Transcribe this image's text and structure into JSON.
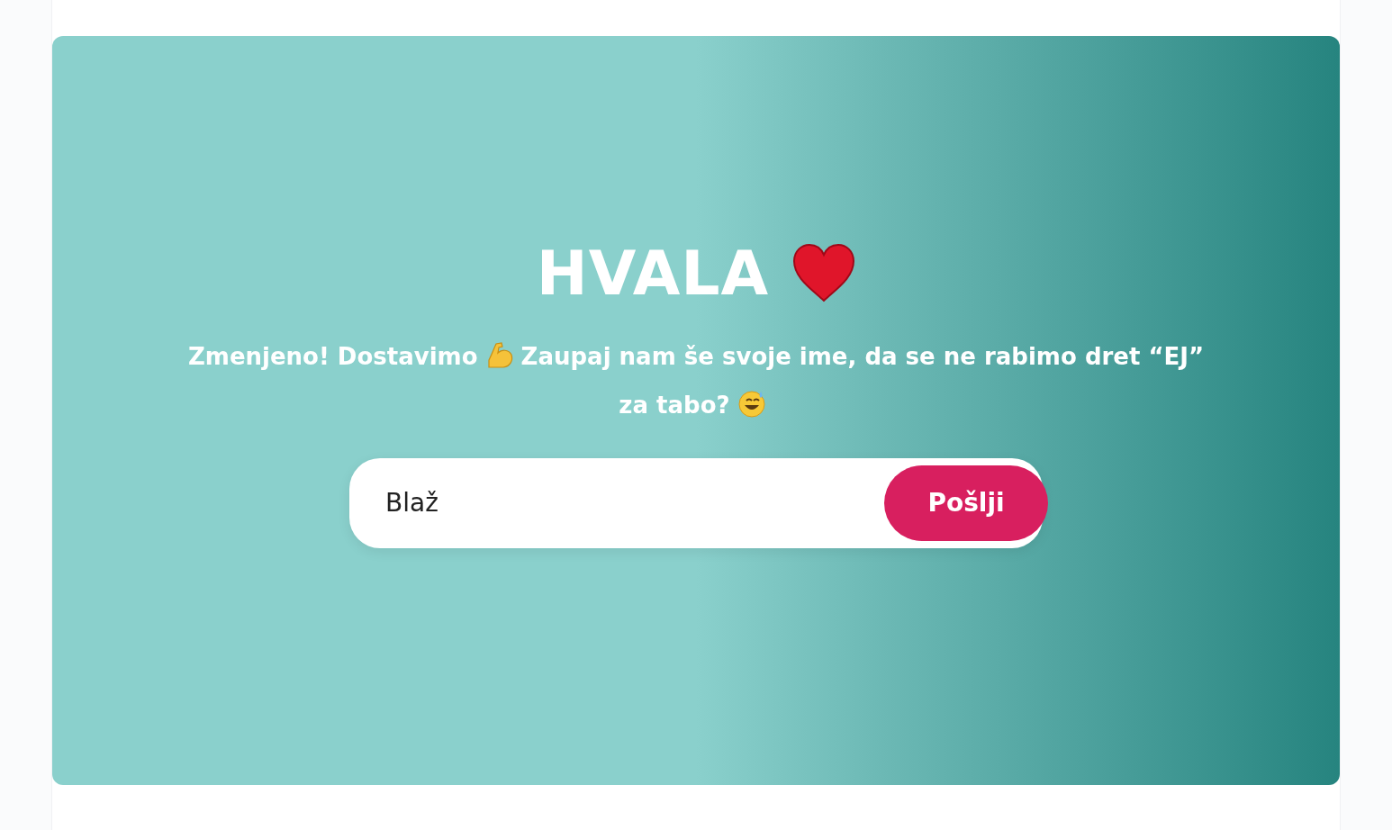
{
  "hero": {
    "title": "HVALA",
    "message": [
      "Zmenjeno! Dostavimo",
      "Zaupaj nam še svoje ime, da se ne rabimo dret “EJ”",
      "za tabo?"
    ],
    "name_field": {
      "value": "Blaž"
    },
    "submit_button": "Pošlji"
  }
}
